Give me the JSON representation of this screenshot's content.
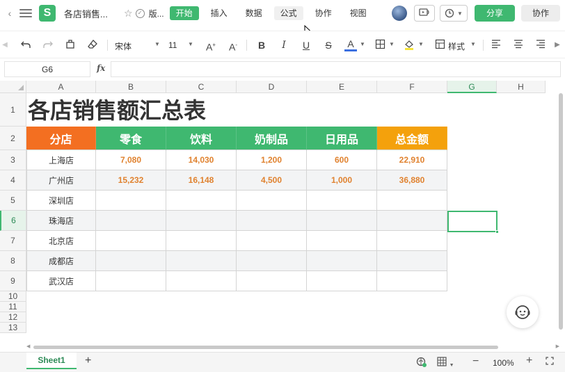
{
  "titlebar": {
    "filename": "各店销售...",
    "version_label": "版...",
    "menu_tabs": [
      {
        "label": "开始"
      },
      {
        "label": "插入"
      },
      {
        "label": "数据"
      },
      {
        "label": "公式"
      },
      {
        "label": "协作"
      },
      {
        "label": "视图"
      }
    ],
    "active_tab": "开始",
    "share_label": "分享",
    "collab_label": "协作",
    "icons": [
      "back-icon",
      "menu-icon",
      "app-logo",
      "star-icon",
      "check-icon",
      "presenter-icon",
      "history-icon"
    ]
  },
  "toolbar": {
    "font_name": "宋体",
    "font_size": "11",
    "style_label": "样式",
    "icons": [
      "undo-icon",
      "redo-icon",
      "format-painter-icon",
      "eraser-icon",
      "increase-font-icon",
      "decrease-font-icon",
      "bold-icon",
      "italic-icon",
      "underline-icon",
      "strikethrough-icon",
      "font-color-icon",
      "border-icon",
      "fill-color-icon",
      "table-style-icon",
      "align-left-icon",
      "align-center-icon",
      "align-right-icon"
    ]
  },
  "formula": {
    "cell_ref": "G6",
    "fx_label": "fx",
    "value": ""
  },
  "grid": {
    "columns": [
      "A",
      "B",
      "C",
      "D",
      "E",
      "F",
      "G",
      "H"
    ],
    "selected_column": "G",
    "rows": [
      "1",
      "2",
      "3",
      "4",
      "5",
      "6",
      "7",
      "8",
      "9",
      "10",
      "11",
      "12",
      "13"
    ],
    "selected_row": "6",
    "title": "各店销售额汇总表",
    "headers": [
      "分店",
      "零食",
      "饮料",
      "奶制品",
      "日用品",
      "总金额"
    ],
    "header_colors": {
      "store": "#f36f21",
      "category": "#3fb870",
      "total": "#f4a10c"
    },
    "data": [
      {
        "store": "上海店",
        "values": [
          "7,080",
          "14,030",
          "1,200",
          "600",
          "22,910"
        ]
      },
      {
        "store": "广州店",
        "values": [
          "15,232",
          "16,148",
          "4,500",
          "1,000",
          "36,880"
        ]
      },
      {
        "store": "深圳店",
        "values": [
          "",
          "",
          "",
          "",
          ""
        ]
      },
      {
        "store": "珠海店",
        "values": [
          "",
          "",
          "",
          "",
          ""
        ]
      },
      {
        "store": "北京店",
        "values": [
          "",
          "",
          "",
          "",
          ""
        ]
      },
      {
        "store": "成都店",
        "values": [
          "",
          "",
          "",
          "",
          ""
        ]
      },
      {
        "store": "武汉店",
        "values": [
          "",
          "",
          "",
          "",
          ""
        ]
      }
    ],
    "value_color": "#e0822f"
  },
  "statusbar": {
    "sheet_tab": "Sheet1",
    "add_sheet": "+",
    "zoom_out": "−",
    "zoom": "100%",
    "zoom_in": "+"
  },
  "accent_color": "#3fb870"
}
